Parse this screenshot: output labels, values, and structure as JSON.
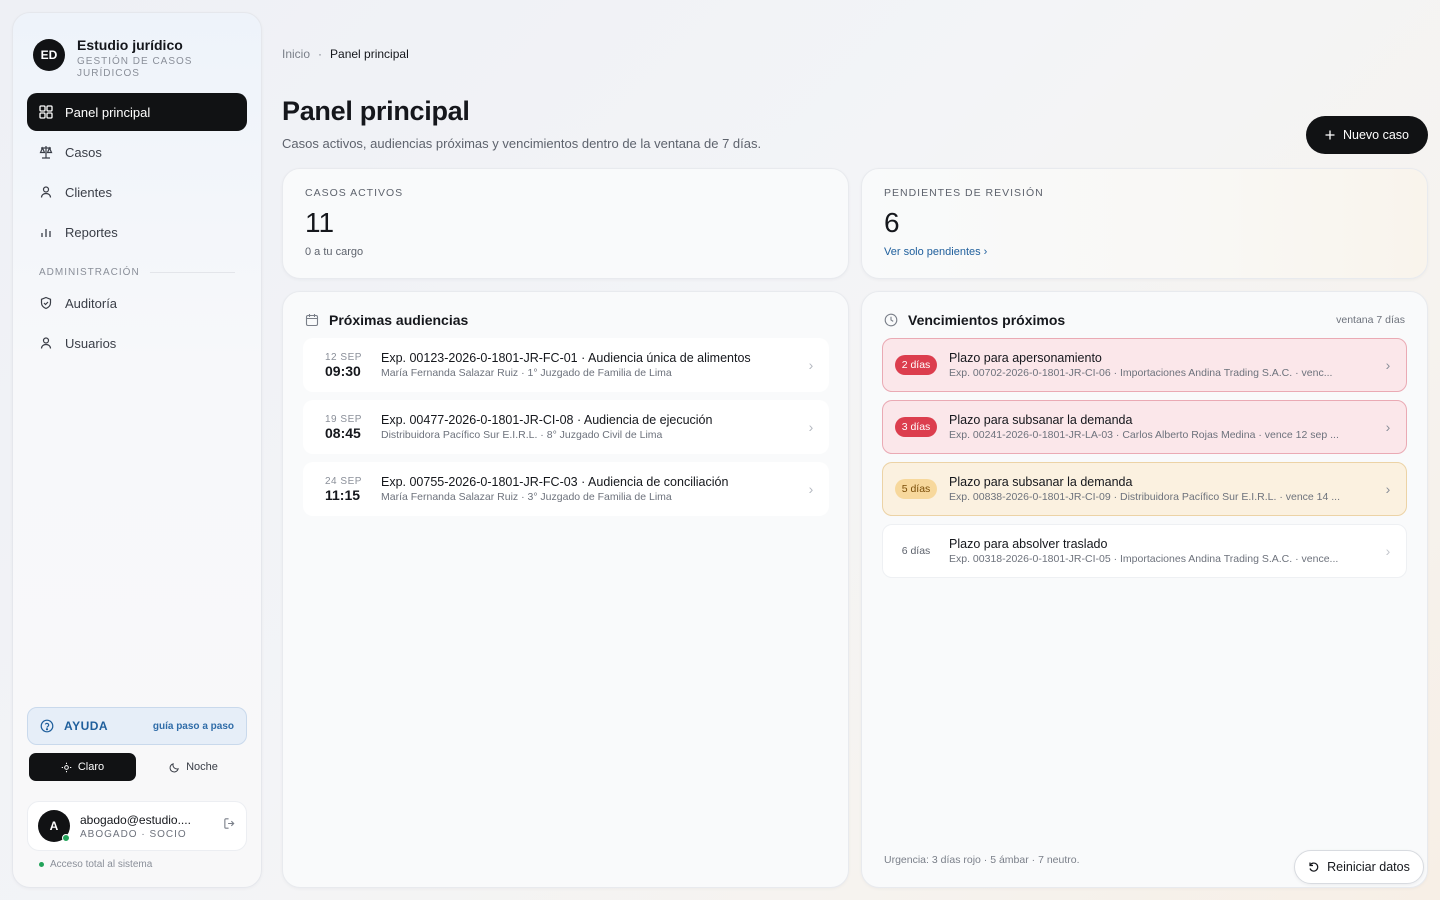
{
  "brand": {
    "logo": "ED",
    "title": "Estudio jurídico",
    "subtitle": "GESTIÓN DE CASOS JURÍDICOS"
  },
  "nav": {
    "items": [
      {
        "label": "Panel principal",
        "icon": "grid-icon",
        "active": true
      },
      {
        "label": "Casos",
        "icon": "scale-icon"
      },
      {
        "label": "Clientes",
        "icon": "user-icon"
      },
      {
        "label": "Reportes",
        "icon": "bar-chart-icon"
      }
    ],
    "admin_section": "ADMINISTRACIÓN",
    "admin_items": [
      {
        "label": "Auditoría",
        "icon": "shield-icon"
      },
      {
        "label": "Usuarios",
        "icon": "user-icon"
      }
    ]
  },
  "help": {
    "label": "AYUDA",
    "link": "guía paso a paso"
  },
  "theme": {
    "light": "Claro",
    "dark": "Noche",
    "selected": "Claro"
  },
  "user": {
    "initial": "A",
    "email": "abogado@estudio....",
    "role": "ABOGADO · SOCIO",
    "access": "Acceso total al sistema"
  },
  "breadcrumb": {
    "home": "Inicio",
    "sep": "·",
    "current": "Panel principal"
  },
  "header": {
    "title": "Panel principal",
    "subtitle": "Casos activos, audiencias próximas y vencimientos dentro de la ventana de 7 días.",
    "new_case": "Nuevo caso"
  },
  "stats": {
    "active": {
      "label": "CASOS ACTIVOS",
      "value": "11",
      "foot": "0 a tu cargo"
    },
    "pending": {
      "label": "PENDIENTES DE REVISIÓN",
      "value": "6",
      "link": "Ver solo pendientes ›"
    }
  },
  "hearings": {
    "title": "Próximas audiencias",
    "items": [
      {
        "day": "12 SEP",
        "time": "09:30",
        "title": "Exp. 00123-2026-0-1801-JR-FC-01 · Audiencia única de alimentos",
        "sub": "María Fernanda Salazar Ruiz · 1° Juzgado de Familia de Lima"
      },
      {
        "day": "19 SEP",
        "time": "08:45",
        "title": "Exp. 00477-2026-0-1801-JR-CI-08 · Audiencia de ejecución",
        "sub": "Distribuidora Pacífico Sur E.I.R.L. · 8° Juzgado Civil de Lima"
      },
      {
        "day": "24 SEP",
        "time": "11:15",
        "title": "Exp. 00755-2026-0-1801-JR-FC-03 · Audiencia de conciliación",
        "sub": "María Fernanda Salazar Ruiz · 3° Juzgado de Familia de Lima"
      }
    ]
  },
  "deadlines": {
    "title": "Vencimientos próximos",
    "meta": "ventana 7 días",
    "items": [
      {
        "badge": "2 días",
        "level": "red",
        "title": "Plazo para apersonamiento",
        "sub": "Exp. 00702-2026-0-1801-JR-CI-06 · Importaciones Andina Trading S.A.C. · venc..."
      },
      {
        "badge": "3 días",
        "level": "red",
        "title": "Plazo para subsanar la demanda",
        "sub": "Exp. 00241-2026-0-1801-JR-LA-03 · Carlos Alberto Rojas Medina · vence 12 sep ..."
      },
      {
        "badge": "5 días",
        "level": "amber",
        "title": "Plazo para subsanar la demanda",
        "sub": "Exp. 00838-2026-0-1801-JR-CI-09 · Distribuidora Pacífico Sur E.I.R.L. · vence 14 ..."
      },
      {
        "badge": "6 días",
        "level": "neutral",
        "title": "Plazo para absolver traslado",
        "sub": "Exp. 00318-2026-0-1801-JR-CI-05 · Importaciones Andina Trading S.A.C. · vence..."
      }
    ],
    "urgency_note": "Urgencia: 3 días rojo · 5 ámbar · 7 neutro."
  },
  "reset_button": "Reiniciar datos",
  "colors": {
    "accent_dark": "#111214",
    "urgent_red": "#dc3e4e",
    "amber": "#f7d89c",
    "link_blue": "#1f5f9c",
    "online_green": "#22a35a"
  }
}
